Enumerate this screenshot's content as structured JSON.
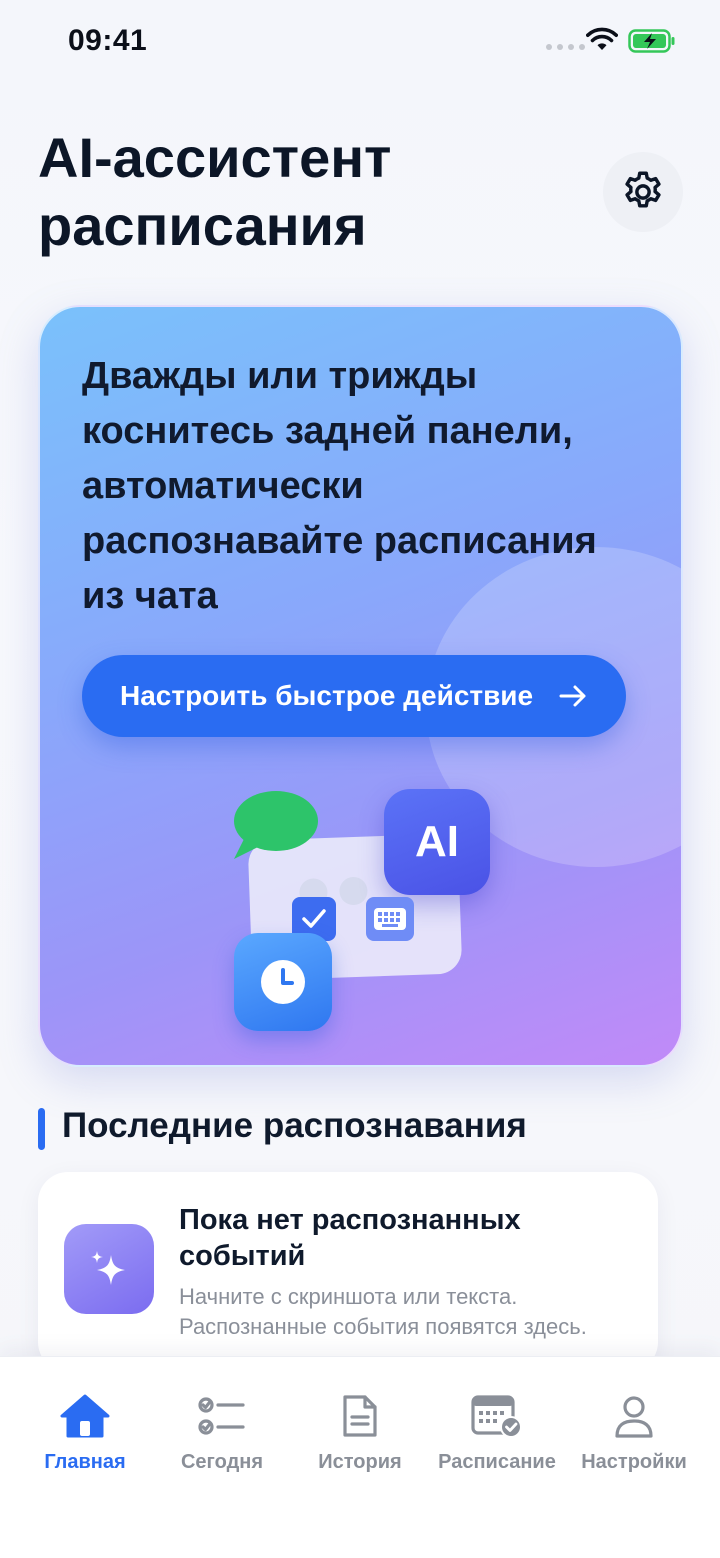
{
  "status_bar": {
    "time": "09:41"
  },
  "header": {
    "title": "AI-ассистент расписания",
    "settings_icon": "gear-icon"
  },
  "hero": {
    "text": "Дважды или трижды коснитесь задней панели, автоматически распознавайте расписания из чата",
    "cta_label": "Настроить быстрое действие",
    "badge_label": "AI",
    "colors": {
      "cta": "#2a6cf2",
      "gradient_start": "#7ac1fb",
      "gradient_end": "#c18af8"
    }
  },
  "recent": {
    "section_title": "Последние распознавания",
    "empty_title": "Пока нет распознанных событий",
    "empty_subtitle": "Начните с скриншота или текста. Распознанные события появятся здесь.",
    "empty_icon": "sparkles-icon"
  },
  "tabs": [
    {
      "label": "Главная",
      "icon": "home-icon",
      "active": true
    },
    {
      "label": "Сегодня",
      "icon": "checklist-icon",
      "active": false
    },
    {
      "label": "История",
      "icon": "document-icon",
      "active": false
    },
    {
      "label": "Расписание",
      "icon": "calendar-check-icon",
      "active": false
    },
    {
      "label": "Настройки",
      "icon": "person-icon",
      "active": false
    }
  ],
  "accent_color": "#2a6cf2"
}
